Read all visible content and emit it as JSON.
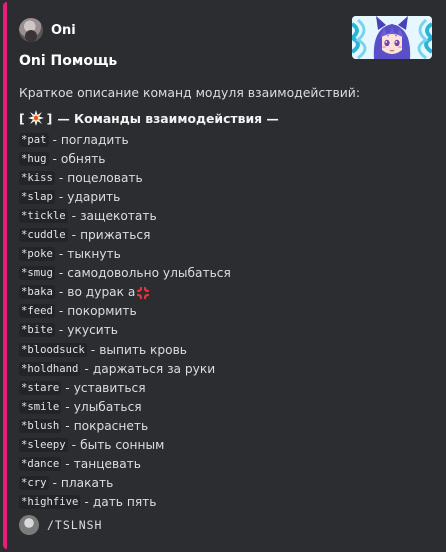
{
  "embed": {
    "accent_color": "#e91e7a",
    "author": {
      "name": "Oni",
      "avatar_icon": "author-avatar-icon"
    },
    "thumbnail_icon": "anime-girl-thumbnail",
    "title": "Oni Помощь",
    "description": "Краткое описание команд модуля взаимодействий:",
    "section_header": {
      "open": "[",
      "icon": "collision-emoji-icon",
      "close": "]",
      "text": "— Команды взаимодействия —"
    },
    "commands": [
      {
        "cmd": "*pat",
        "sep": "-",
        "desc": "погладить"
      },
      {
        "cmd": "*hug",
        "sep": "-",
        "desc": "обнять"
      },
      {
        "cmd": "*kiss",
        "sep": "-",
        "desc": "поцеловать"
      },
      {
        "cmd": "*slap",
        "sep": "-",
        "desc": "ударить"
      },
      {
        "cmd": "*tickle",
        "sep": "-",
        "desc": "защекотать"
      },
      {
        "cmd": "*cuddle",
        "sep": "-",
        "desc": "прижаться"
      },
      {
        "cmd": "*poke",
        "sep": "-",
        "desc": "тыкнуть"
      },
      {
        "cmd": "*smug",
        "sep": "-",
        "desc": "самодовольно улыбаться"
      },
      {
        "cmd": "*baka",
        "sep": "-",
        "desc": "во дурак а",
        "emoji": "anger-symbol-icon"
      },
      {
        "cmd": "*feed",
        "sep": "-",
        "desc": "покормить"
      },
      {
        "cmd": "*bite",
        "sep": "-",
        "desc": "укусить"
      },
      {
        "cmd": "*bloodsuck",
        "sep": "-",
        "desc": "выпить кровь"
      },
      {
        "cmd": "*holdhand",
        "sep": "-",
        "desc": "даржаться за руки"
      },
      {
        "cmd": "*stare",
        "sep": "-",
        "desc": "уставиться"
      },
      {
        "cmd": "*smile",
        "sep": "-",
        "desc": "улыбаться"
      },
      {
        "cmd": "*blush",
        "sep": "-",
        "desc": "покраснеть"
      },
      {
        "cmd": "*sleepy",
        "sep": "-",
        "desc": "быть сонным"
      },
      {
        "cmd": "*dance",
        "sep": "-",
        "desc": "танцевать"
      },
      {
        "cmd": "*cry",
        "sep": "-",
        "desc": "плакать"
      },
      {
        "cmd": "*highfive",
        "sep": "-",
        "desc": "дать пять"
      }
    ],
    "footer": {
      "text": "/TSLNSH",
      "icon": "footer-icon"
    }
  }
}
